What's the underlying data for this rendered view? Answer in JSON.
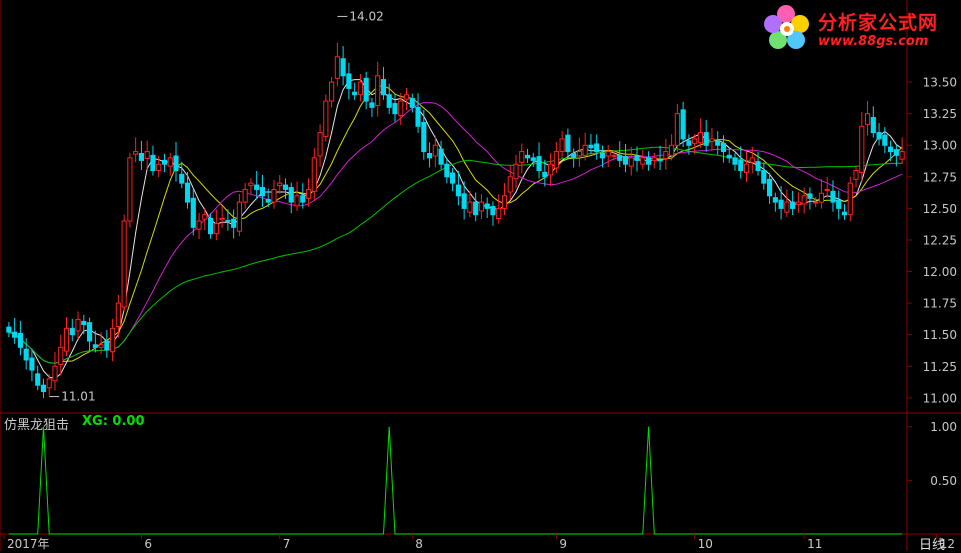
{
  "logo": {
    "title": "分析家公式网",
    "url": "www.88gs.com"
  },
  "indicator": {
    "name": "仿黑龙狙击",
    "value_label": "XG: 0.00"
  },
  "period_label": "日线",
  "colors": {
    "background": "#000000",
    "axis": "#8a0000",
    "up": "#ff2020",
    "down": "#00d8f0",
    "ma5": "#e6e6e6",
    "ma10": "#d8d800",
    "ma20": "#d020d0",
    "ma60": "#00c000",
    "signal": "#00e000",
    "label": "#c8c8c8"
  },
  "chart_data": [
    {
      "type": "candlestick",
      "title": "",
      "y_ticks": [
        "11.00",
        "11.25",
        "11.50",
        "11.75",
        "12.00",
        "12.25",
        "12.50",
        "12.75",
        "13.00",
        "13.25",
        "13.50"
      ],
      "ylim": [
        10.88,
        14.15
      ],
      "x_ticks": [
        {
          "label": "2017年",
          "index": 0
        },
        {
          "label": "6",
          "index": 23
        },
        {
          "label": "7",
          "index": 47
        },
        {
          "label": "8",
          "index": 70
        },
        {
          "label": "9",
          "index": 95
        },
        {
          "label": "10",
          "index": 119
        },
        {
          "label": "11",
          "index": 138
        },
        {
          "label": "12",
          "index": 161
        }
      ],
      "annotations": [
        {
          "text": "14.02",
          "index": 57,
          "value": 14.02
        },
        {
          "text": "11.01",
          "index": 7,
          "value": 11.01
        }
      ],
      "closes": [
        11.52,
        11.48,
        11.4,
        11.3,
        11.22,
        11.1,
        11.05,
        11.15,
        11.25,
        11.4,
        11.55,
        11.5,
        11.62,
        11.58,
        11.45,
        11.4,
        11.42,
        11.38,
        11.55,
        11.75,
        12.4,
        12.9,
        12.95,
        12.88,
        12.95,
        12.8,
        12.85,
        12.85,
        12.9,
        12.8,
        12.7,
        12.55,
        12.35,
        12.4,
        12.45,
        12.3,
        12.38,
        12.42,
        12.4,
        12.35,
        12.55,
        12.65,
        12.7,
        12.65,
        12.6,
        12.55,
        12.65,
        12.7,
        12.65,
        12.55,
        12.6,
        12.55,
        12.65,
        12.9,
        13.1,
        13.35,
        13.5,
        13.7,
        13.55,
        13.45,
        13.4,
        13.5,
        13.35,
        13.3,
        13.55,
        13.4,
        13.3,
        13.25,
        13.35,
        13.4,
        13.3,
        13.15,
        12.95,
        12.9,
        13.0,
        12.85,
        12.75,
        12.7,
        12.6,
        12.5,
        12.55,
        12.45,
        12.55,
        12.5,
        12.45,
        12.5,
        12.6,
        12.75,
        12.85,
        12.95,
        12.9,
        12.88,
        12.8,
        12.75,
        12.85,
        12.95,
        13.05,
        12.95,
        12.9,
        12.95,
        13.0,
        12.98,
        12.95,
        12.9,
        12.95,
        12.92,
        12.88,
        12.85,
        12.9,
        12.88,
        12.9,
        12.85,
        12.9,
        12.88,
        12.95,
        13.0,
        13.25,
        13.05,
        13.0,
        13.05,
        13.1,
        13.0,
        13.05,
        13.0,
        12.95,
        12.9,
        12.85,
        12.8,
        12.85,
        12.9,
        12.8,
        12.7,
        12.6,
        12.55,
        12.5,
        12.55,
        12.5,
        12.55,
        12.6,
        12.58,
        12.55,
        12.62,
        12.65,
        12.55,
        12.5,
        12.45,
        12.7,
        12.8,
        13.15,
        13.25,
        13.1,
        13.05,
        13.0,
        12.95,
        12.92,
        12.95
      ],
      "ma_series": [
        {
          "key": "ma5",
          "period": 5
        },
        {
          "key": "ma10",
          "period": 10
        },
        {
          "key": "ma20",
          "period": 20
        },
        {
          "key": "ma60",
          "period": 60
        }
      ]
    },
    {
      "type": "line",
      "title": "",
      "y_ticks": [
        "0.50",
        "1.00"
      ],
      "ylim": [
        0,
        1.1
      ],
      "signal_indices": [
        6,
        66,
        111
      ]
    }
  ]
}
